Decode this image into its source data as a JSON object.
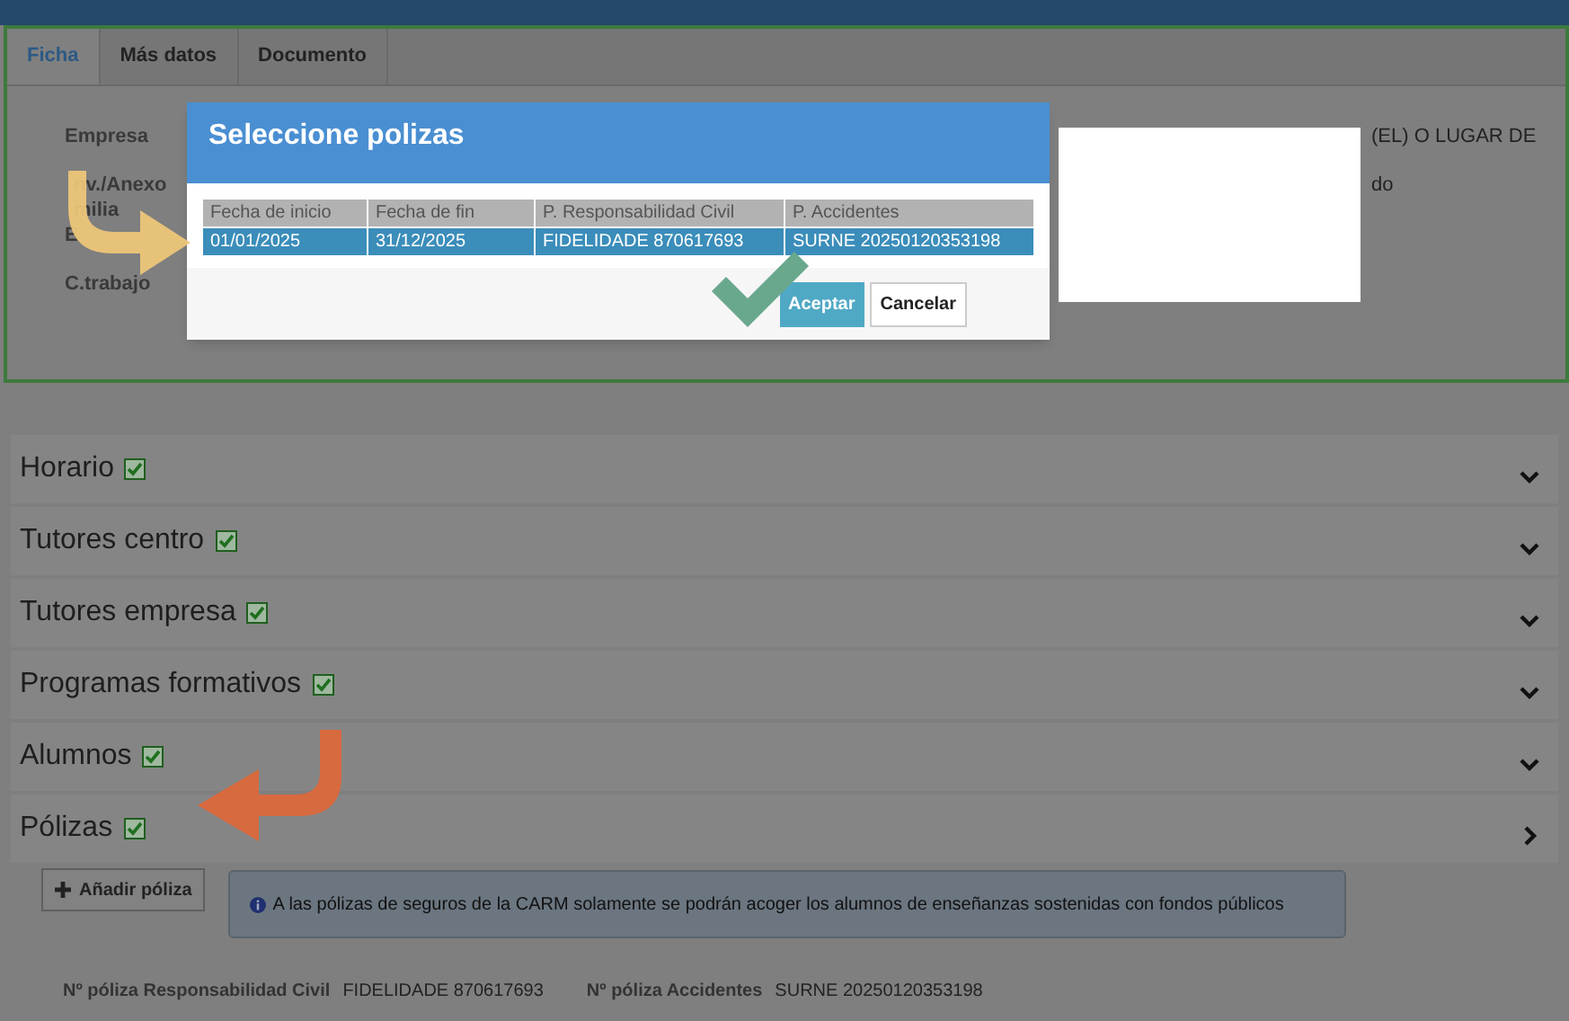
{
  "tabs": [
    {
      "label": "Ficha",
      "selected": true
    },
    {
      "label": "Más datos",
      "selected": false
    },
    {
      "label": "Documento",
      "selected": false
    }
  ],
  "form": {
    "labels": [
      "Empresa",
      "nv./Anexo",
      "milia",
      "E",
      "C.trabajo"
    ],
    "right_fragments": [
      "(EL) O LUGAR DE",
      "do"
    ]
  },
  "dialog": {
    "title": "Seleccione polizas",
    "columns": [
      "Fecha de inicio",
      "Fecha de fin",
      "P. Responsabilidad Civil",
      "P. Accidentes"
    ],
    "rows": [
      {
        "selected": true,
        "cells": [
          "01/01/2025",
          "31/12/2025",
          "FIDELIDADE 870617693",
          "SURNE 20250120353198"
        ]
      }
    ],
    "buttons": [
      {
        "label": "Aceptar",
        "kind": "primary"
      },
      {
        "label": "Cancelar",
        "kind": "default"
      }
    ]
  },
  "sections": [
    {
      "title": "Horario",
      "checked": true,
      "expanded": false
    },
    {
      "title": "Tutores centro",
      "checked": true,
      "expanded": false
    },
    {
      "title": "Tutores empresa",
      "checked": true,
      "expanded": false
    },
    {
      "title": "Programas formativos",
      "checked": true,
      "expanded": false
    },
    {
      "title": "Alumnos",
      "checked": true,
      "expanded": false
    },
    {
      "title": "Pólizas",
      "checked": true,
      "expanded": true
    }
  ],
  "polizas": {
    "add_button": "Añadir póliza",
    "info": "A las pólizas de seguros de la CARM solamente se podrán acoger los alumnos de enseñanzas sostenidas con fondos públicos",
    "fields": [
      {
        "label": "Nº póliza Responsabilidad Civil",
        "value": "FIDELIDADE 870617693"
      },
      {
        "label": "Nº póliza Accidentes",
        "value": "SURNE 20250120353198"
      }
    ]
  }
}
